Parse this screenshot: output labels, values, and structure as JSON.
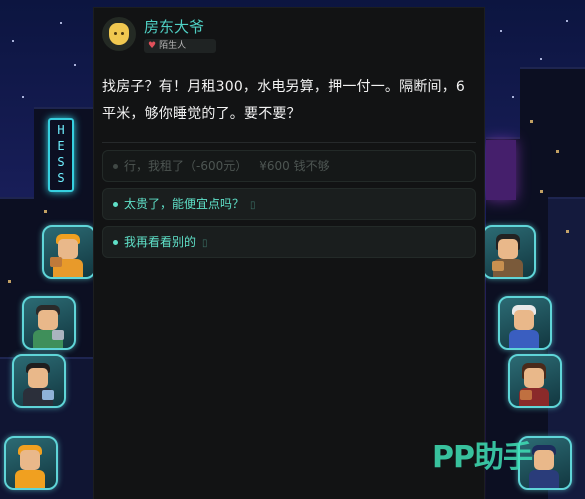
{
  "npc": {
    "name": "房东大爷",
    "relation": "陌生人",
    "speech": "找房子？有！月租300，水电另算，押一付一。隔断间，6平米，够你睡觉的了。要不要？"
  },
  "choices": [
    {
      "dot": "•",
      "label": "行，我租了（-600元）",
      "price": "¥600",
      "reason": "钱不够",
      "enabled": false
    },
    {
      "dot": "•",
      "label": "太贵了，能便宜点吗？",
      "tail": "▯",
      "enabled": true
    },
    {
      "dot": "•",
      "label": "我再看看别的",
      "tail": "▯",
      "enabled": true
    }
  ],
  "watermark": "PP助手",
  "colors": {
    "accent": "#4fd0c4",
    "panel": "#121314",
    "choice_active": "#5fe0c8",
    "heart": "#e0505a"
  }
}
